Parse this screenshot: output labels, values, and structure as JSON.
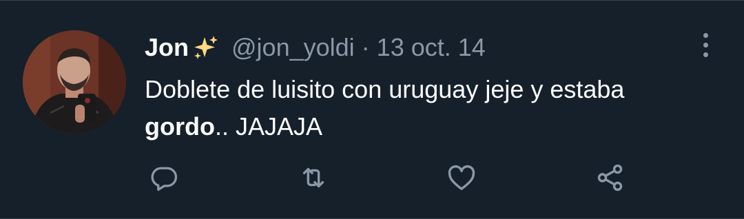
{
  "tweet": {
    "author_name": "Jon",
    "author_emoji": "sparkles-icon",
    "handle": "@jon_yoldi",
    "separator": "·",
    "date": "13 oct. 14",
    "text_line1": "Doblete de luisito con uruguay jeje y estaba",
    "text_bold": "gordo",
    "text_rest": ".. JAJAJA"
  },
  "actions": [
    "reply-icon",
    "retweet-icon",
    "like-icon",
    "share-icon"
  ],
  "colors": {
    "background": "#15202b",
    "text": "#ffffff",
    "muted": "#8b98a5",
    "border": "#38444d",
    "sparkle": "#ffd983"
  }
}
